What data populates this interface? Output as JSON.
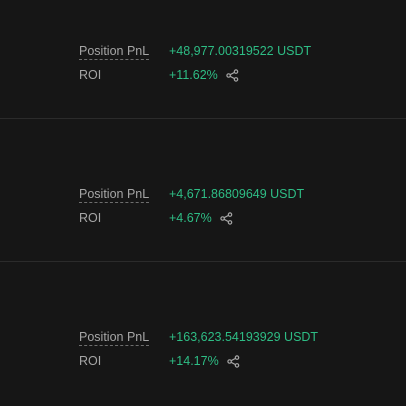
{
  "positions": [
    {
      "pnl_label": "Position PnL",
      "pnl_value": "+48,977.00319522 USDT",
      "roi_label": "ROI",
      "roi_value": "+11.62%"
    },
    {
      "pnl_label": "Position PnL",
      "pnl_value": "+4,671.86809649 USDT",
      "roi_label": "ROI",
      "roi_value": "+4.67%"
    },
    {
      "pnl_label": "Position PnL",
      "pnl_value": "+163,623.54193929 USDT",
      "roi_label": "ROI",
      "roi_value": "+14.17%"
    }
  ],
  "icons": {
    "share": "share-icon"
  },
  "colors": {
    "positive": "#2ebd85",
    "background": "#161616",
    "label": "#a6a6a6"
  }
}
